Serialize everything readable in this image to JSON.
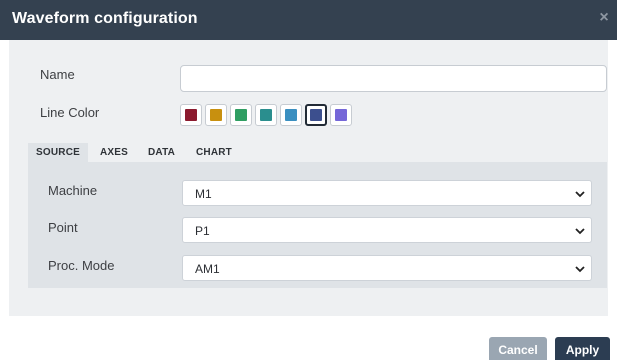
{
  "dialog": {
    "title": "Waveform configuration",
    "close_icon": "close-icon"
  },
  "form": {
    "name_label": "Name",
    "name_value": "",
    "line_color_label": "Line Color",
    "line_colors": [
      {
        "color": "#8b1a2e",
        "selected": false
      },
      {
        "color": "#c8900f",
        "selected": false
      },
      {
        "color": "#2f9e62",
        "selected": false
      },
      {
        "color": "#2a8e8e",
        "selected": false
      },
      {
        "color": "#3a8fc0",
        "selected": false
      },
      {
        "color": "#3c4f8e",
        "selected": true
      },
      {
        "color": "#7567d8",
        "selected": false
      }
    ]
  },
  "tabs": [
    {
      "label": "SOURCE",
      "active": true
    },
    {
      "label": "AXES",
      "active": false
    },
    {
      "label": "DATA",
      "active": false
    },
    {
      "label": "CHART",
      "active": false
    }
  ],
  "source": {
    "machine_label": "Machine",
    "machine_value": "M1",
    "point_label": "Point",
    "point_value": "P1",
    "proc_mode_label": "Proc. Mode",
    "proc_mode_value": "AM1"
  },
  "footer": {
    "cancel_label": "Cancel",
    "apply_label": "Apply"
  }
}
